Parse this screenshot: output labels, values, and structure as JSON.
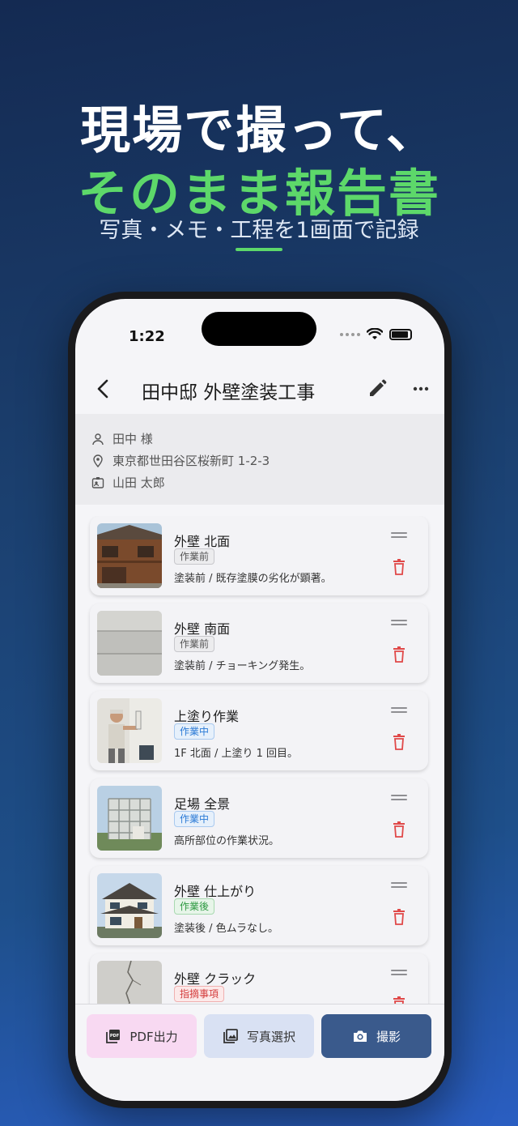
{
  "promo": {
    "line1": "現場で撮って、",
    "line2": "そのまま報告書",
    "subtitle": "写真・メモ・工程を1画面で記録"
  },
  "status_bar": {
    "time": "1:22"
  },
  "app_bar": {
    "title": "田中邸 外壁塗装工事"
  },
  "info": {
    "client": "田中 様",
    "address": "東京都世田谷区桜新町 1-2-3",
    "staff": "山田 太郎"
  },
  "entries": [
    {
      "title": "外壁 北面",
      "tag": "作業前",
      "tag_type": "before",
      "note": "塗装前 / 既存塗膜の劣化が顕著。",
      "thumb": "old-wooden-house"
    },
    {
      "title": "外壁 南面",
      "tag": "作業前",
      "tag_type": "before",
      "note": "塗装前 / チョーキング発生。",
      "thumb": "siding-closeup"
    },
    {
      "title": "上塗り作業",
      "tag": "作業中",
      "tag_type": "during",
      "note": "1F 北面 / 上塗り 1 回目。",
      "thumb": "painter-working"
    },
    {
      "title": "足場 全景",
      "tag": "作業中",
      "tag_type": "during",
      "note": "高所部位の作業状況。",
      "thumb": "scaffolding-house"
    },
    {
      "title": "外壁 仕上がり",
      "tag": "作業後",
      "tag_type": "after",
      "note": "塗装後 / 色ムラなし。",
      "thumb": "finished-house"
    },
    {
      "title": "外壁 クラック",
      "tag": "指摘事項",
      "tag_type": "issue",
      "note": "",
      "thumb": "wall-crack"
    }
  ],
  "actions": {
    "pdf_label": "PDF出力",
    "photo_label": "写真選択",
    "camera_label": "撮影"
  },
  "colors": {
    "accent_green": "#5dd86a",
    "camera_button": "#3a5a8c",
    "delete_red": "#e04848",
    "tag_during": "#2b7ad6",
    "tag_after": "#2e9a42",
    "tag_issue": "#d43d3d"
  }
}
